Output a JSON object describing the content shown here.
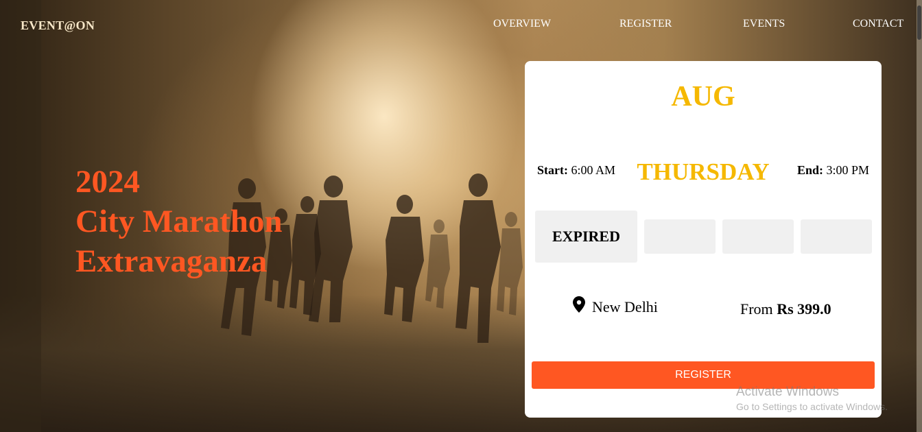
{
  "brand": "EVENT@ON",
  "nav": {
    "overview": "OVERVIEW",
    "register": "REGISTER",
    "events": "EVENTS",
    "contact": "CONTACT"
  },
  "hero": {
    "line1": "2024",
    "line2": "City Marathon",
    "line3": "Extravaganza"
  },
  "card": {
    "month": "AUG",
    "start_label": "Start:",
    "start_time": "6:00 AM",
    "weekday": "THURSDAY",
    "end_label": "End:",
    "end_time": "3:00 PM",
    "status": "EXPIRED",
    "location": "New Delhi",
    "price_prefix": "From",
    "price_currency": "Rs",
    "price_amount": "399.0",
    "register_label": "REGISTER",
    "location_icon": "map-pin-icon"
  },
  "watermark": {
    "title": "Activate Windows",
    "subtitle": "Go to Settings to activate Windows."
  },
  "colors": {
    "accent_orange": "#ff5722",
    "accent_yellow": "#f5b800",
    "card_bg": "#ffffff",
    "slot_bg": "#f0f0f0"
  }
}
